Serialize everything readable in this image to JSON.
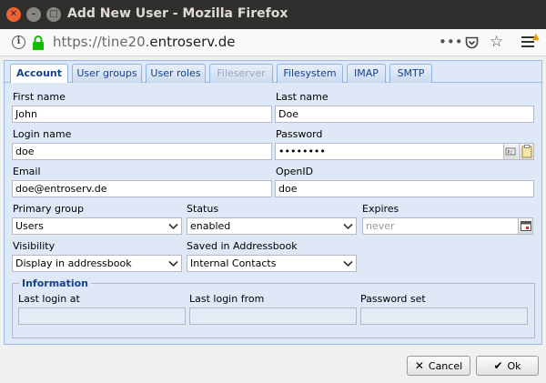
{
  "window": {
    "title": "Add New User - Mozilla Firefox"
  },
  "browser": {
    "url_prefix": "https://tine20.",
    "url_domain": "entroserv.de",
    "dots": "•••"
  },
  "tabs": [
    {
      "label": "Account",
      "state": "active"
    },
    {
      "label": "User groups",
      "state": "normal"
    },
    {
      "label": "User roles",
      "state": "normal"
    },
    {
      "label": "Fileserver",
      "state": "disabled"
    },
    {
      "label": "Filesystem",
      "state": "normal"
    },
    {
      "label": "IMAP",
      "state": "normal"
    },
    {
      "label": "SMTP",
      "state": "normal"
    }
  ],
  "form": {
    "first_name": {
      "label": "First name",
      "value": "John"
    },
    "last_name": {
      "label": "Last name",
      "value": "Doe"
    },
    "login_name": {
      "label": "Login name",
      "value": "doe"
    },
    "password": {
      "label": "Password",
      "value": "••••••••"
    },
    "email": {
      "label": "Email",
      "value": "doe@entroserv.de"
    },
    "openid": {
      "label": "OpenID",
      "value": "doe"
    },
    "primary_group": {
      "label": "Primary group",
      "value": "Users"
    },
    "status": {
      "label": "Status",
      "value": "enabled"
    },
    "expires": {
      "label": "Expires",
      "placeholder": "never"
    },
    "visibility": {
      "label": "Visibility",
      "value": "Display in addressbook"
    },
    "saved_in": {
      "label": "Saved in Addressbook",
      "value": "Internal Contacts"
    }
  },
  "information": {
    "legend": "Information",
    "last_login_at": {
      "label": "Last login at",
      "value": ""
    },
    "last_login_from": {
      "label": "Last login from",
      "value": ""
    },
    "password_set": {
      "label": "Password set",
      "value": ""
    }
  },
  "buttons": {
    "cancel": "Cancel",
    "ok": "Ok"
  }
}
